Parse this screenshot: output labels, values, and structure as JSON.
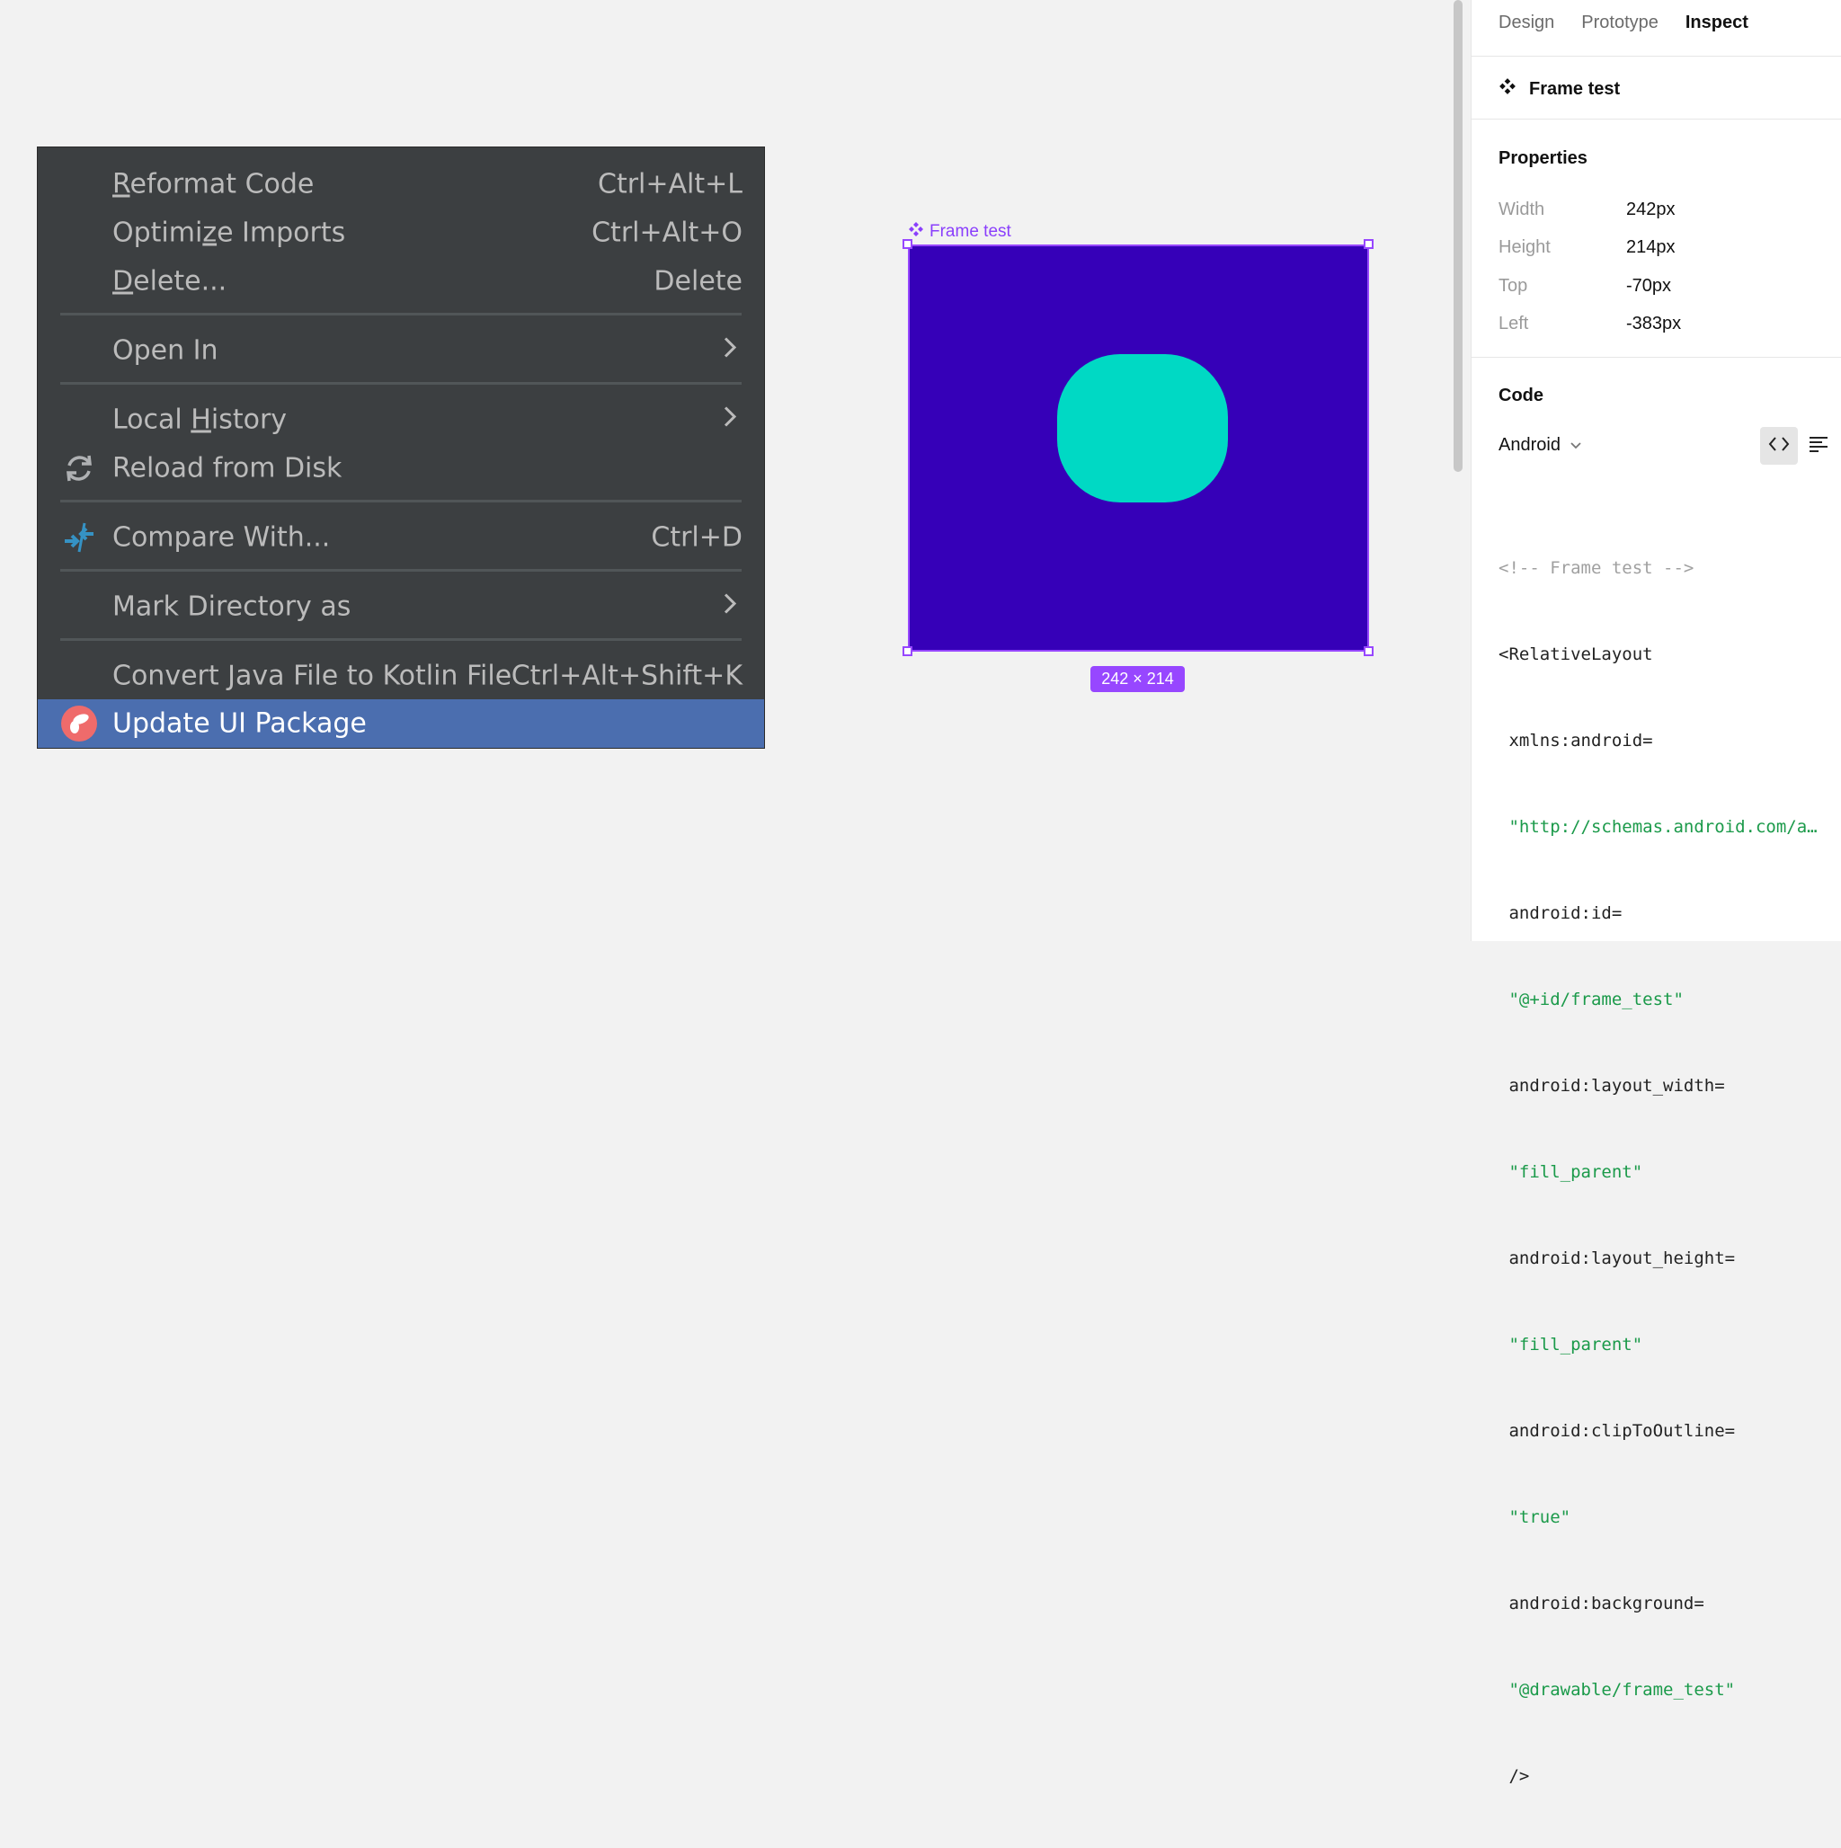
{
  "context_menu": {
    "items": [
      {
        "label_pre": "",
        "label_u": "R",
        "label_post": "eformat Code",
        "shortcut": "Ctrl+Alt+L"
      },
      {
        "label_pre": "Optimi",
        "label_u": "z",
        "label_post": "e Imports",
        "shortcut": "Ctrl+Alt+O"
      },
      {
        "label_pre": "",
        "label_u": "D",
        "label_post": "elete...",
        "shortcut": "Delete"
      },
      {
        "label": "Open In",
        "submenu": true
      },
      {
        "label_pre": "Local ",
        "label_u": "H",
        "label_post": "istory",
        "submenu": true
      },
      {
        "label": "Reload from Disk",
        "icon": "reload-icon"
      },
      {
        "label": "Compare With...",
        "shortcut": "Ctrl+D",
        "icon": "compare-icon"
      },
      {
        "label": "Mark Directory as",
        "submenu": true
      },
      {
        "label": "Convert Java File to Kotlin File",
        "shortcut": "Ctrl+Alt+Shift+K"
      },
      {
        "label": "Update UI Package",
        "icon": "plugin-logo-icon",
        "selected": true
      }
    ],
    "submenu_glyph": "›"
  },
  "canvas": {
    "frame_name": "Frame test",
    "frame_size": "242 × 214",
    "colors": {
      "frame_fill": "#3600b8",
      "shape_fill": "#00d9c4",
      "selection": "#9747ff"
    }
  },
  "panel": {
    "tabs": [
      "Design",
      "Prototype",
      "Inspect"
    ],
    "active_tab": "Inspect",
    "component_name": "Frame test",
    "properties_title": "Properties",
    "properties": [
      {
        "key": "Width",
        "value": "242px"
      },
      {
        "key": "Height",
        "value": "214px"
      },
      {
        "key": "Top",
        "value": "-70px"
      },
      {
        "key": "Left",
        "value": "-383px"
      }
    ],
    "code_title": "Code",
    "platform": "Android",
    "code_lines": [
      {
        "text": "<!-- Frame test -->",
        "kind": "comment"
      },
      {
        "text": "<RelativeLayout",
        "kind": "tag"
      },
      {
        "text": " xmlns:android=",
        "kind": "attr"
      },
      {
        "text": " \"http://schemas.android.com/a…",
        "kind": "string"
      },
      {
        "text": " android:id=",
        "kind": "attr"
      },
      {
        "text": " \"@+id/frame_test\"",
        "kind": "string"
      },
      {
        "text": " android:layout_width=",
        "kind": "attr"
      },
      {
        "text": " \"fill_parent\"",
        "kind": "string"
      },
      {
        "text": " android:layout_height=",
        "kind": "attr"
      },
      {
        "text": " \"fill_parent\"",
        "kind": "string"
      },
      {
        "text": " android:clipToOutline=",
        "kind": "attr"
      },
      {
        "text": " \"true\"",
        "kind": "string"
      },
      {
        "text": " android:background=",
        "kind": "attr"
      },
      {
        "text": " \"@drawable/frame_test\"",
        "kind": "string"
      },
      {
        "text": " />",
        "kind": "tag"
      }
    ]
  }
}
